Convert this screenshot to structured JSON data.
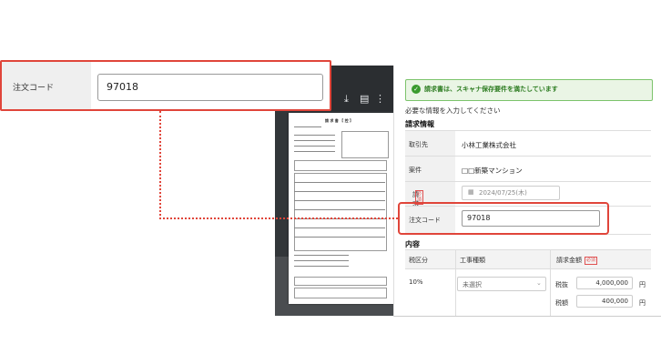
{
  "viewer": {
    "icons": [
      "download-icon",
      "print-icon",
      "more-icon"
    ],
    "doc_title": "請 求 書 【 控 】"
  },
  "callout": {
    "label": "注文コード",
    "value": "97018"
  },
  "form": {
    "alert": {
      "icon": "check-icon",
      "text": "請求書は、スキャナ保存要件を満たしています",
      "color": "#2e7d22"
    },
    "hint": "必要な情報を入力してください",
    "invoice_section_title": "請求情報",
    "fields": {
      "vendor": {
        "label": "取引先",
        "value": "小林工業株式会社"
      },
      "project": {
        "label": "案件",
        "value": "□□新築マンション"
      },
      "date": {
        "label": "請求日",
        "required": "必須",
        "value": "2024/07/25(木)"
      },
      "order_code": {
        "label": "注文コード",
        "value": "97018"
      }
    },
    "details_section_title": "内容",
    "table": {
      "headers": {
        "tax": "税区分",
        "work_type": "工事種類",
        "amount": "請求金額",
        "required": "必須"
      },
      "row": {
        "tax": "10%",
        "work_type": "未選択",
        "pre_tax_label": "税抜",
        "pre_tax_value": "4,000,000",
        "tax_label": "税額",
        "tax_value": "400,000",
        "currency": "円"
      }
    }
  },
  "colors": {
    "highlight": "#e0453a",
    "alert_bg": "#eaf5e5",
    "viewer_bg": "#323639"
  }
}
